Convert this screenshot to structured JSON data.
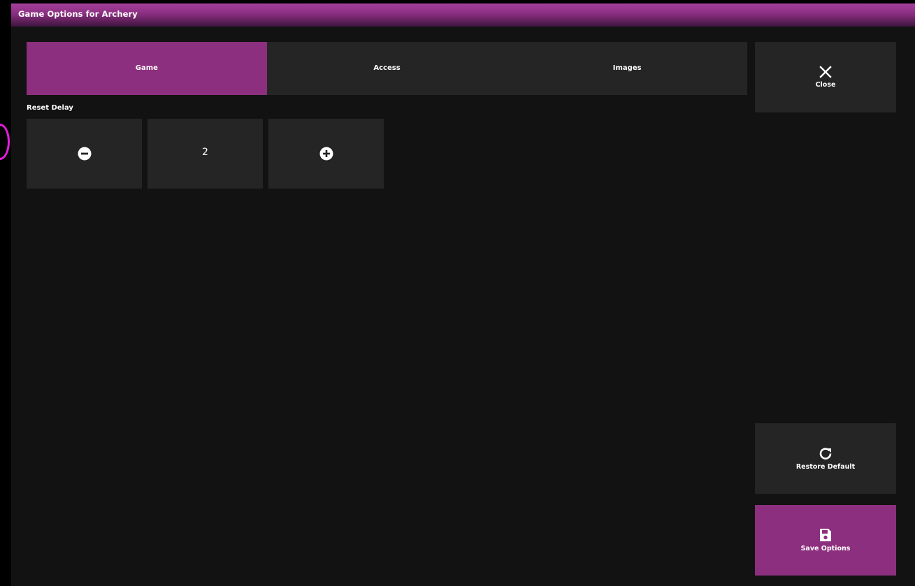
{
  "window": {
    "title": "Game Options for Archery"
  },
  "tabs": [
    {
      "label": "Game",
      "active": true
    },
    {
      "label": "Access",
      "active": false
    },
    {
      "label": "Images",
      "active": false
    }
  ],
  "reset_delay": {
    "label": "Reset Delay",
    "value": "2",
    "decrement_icon": "minus-circle-icon",
    "increment_icon": "plus-circle-icon"
  },
  "side_buttons": {
    "close": {
      "label": "Close",
      "icon": "close-icon"
    },
    "restore": {
      "label": "Restore Default",
      "icon": "refresh-icon"
    },
    "save": {
      "label": "Save Options",
      "icon": "floppy-disk-icon"
    }
  },
  "colors": {
    "accent": "#8c2f7e",
    "panel": "#252525",
    "background": "#121212"
  }
}
